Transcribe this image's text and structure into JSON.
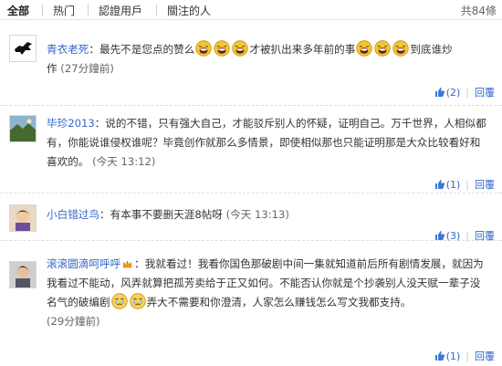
{
  "tabs": {
    "all": "全部",
    "hot": "热门",
    "verified": "認證用戶",
    "following": "關注的人",
    "total": "共84條"
  },
  "comments": [
    {
      "user": "青衣老死",
      "text_a": "：最先不是您点的赞么",
      "text_b": "才被扒出来多年前的事",
      "text_c": "到底谁炒",
      "text_d": "作",
      "time": "(27分鐘前)",
      "likes": "(2)",
      "reply": "回覆"
    },
    {
      "user": "毕珍2013",
      "text": "：说的不错，只有强大自己，才能驳斥别人的怀疑，证明自己。万千世界，人相似都有，你能说谁侵权谁呢？毕竟创作就那么多情景，即使相似那也只能证明那是大众比较看好和喜欢的。",
      "time": "(今天 13:12)",
      "likes": "(1)",
      "reply": "回覆"
    },
    {
      "user": "小白错过鸟",
      "text": "：有本事不要删天涯8帖呀",
      "time": "(今天 13:13)",
      "likes": "(3)",
      "reply": "回覆"
    },
    {
      "user": "滚滚圆滴呵呼呼",
      "text_a": "：我就看过！我看你国色那破剧中间一集就知道前后所有剧情发展，就因为我看过不能动，风弄就算把孤芳卖给于正又如何。不能否认你就是个抄袭别人没天赋一辈子没名气的破编剧",
      "text_b": "弄大不需要和你澄清，人家怎么赚钱怎么写文我都支持。",
      "time": "(29分鐘前)",
      "likes": "(1)",
      "reply": "回覆"
    }
  ]
}
